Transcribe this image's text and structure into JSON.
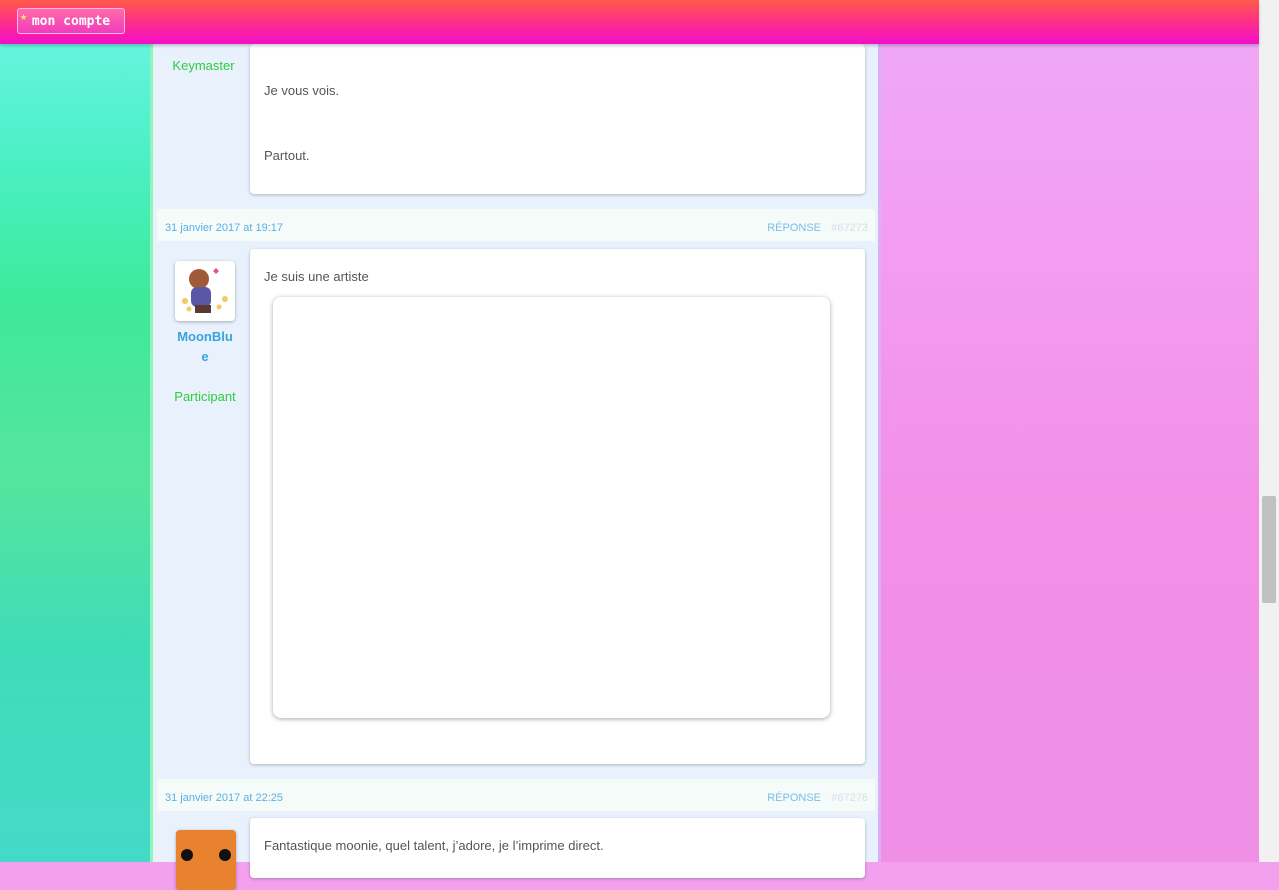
{
  "header": {
    "account_label": "mon compte"
  },
  "posts": [
    {
      "role": "Keymaster",
      "lines": [
        "Je vous vois.",
        "Partout."
      ]
    },
    {
      "date": "31 janvier 2017 at 19:17",
      "reply_label": "Réponse",
      "post_id": "#67273",
      "author": "MoonBlue",
      "role": "Participant",
      "text": "Je suis une artiste"
    },
    {
      "date": "31 janvier 2017 at 22:25",
      "reply_label": "Réponse",
      "post_id": "#67276",
      "text": "Fantastique moonie, quel talent, j’adore, je l’imprime direct."
    }
  ],
  "colors": {
    "topbar": "#ff2e8a",
    "link": "#3aa3dc",
    "role": "#2ecc40",
    "meta_date": "#5bb0e6"
  }
}
